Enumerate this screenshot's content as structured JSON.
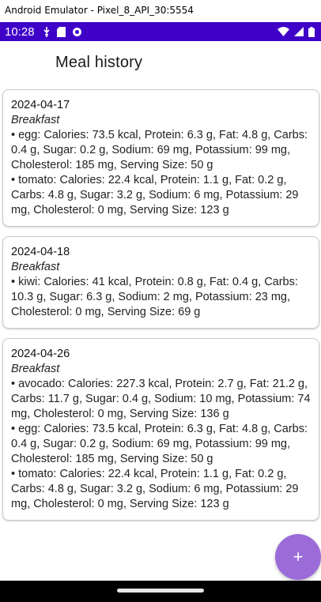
{
  "window": {
    "title": "Android Emulator - Pixel_8_API_30:5554"
  },
  "status_bar": {
    "time": "10:28",
    "icons": [
      "usb-debug-icon",
      "sd-card-icon",
      "sync-icon",
      "wifi-icon",
      "signal-icon",
      "battery-icon"
    ]
  },
  "header": {
    "title": "Meal history"
  },
  "meals": [
    {
      "date": "2024-04-17",
      "meal_type": "Breakfast",
      "items": [
        "• egg: Calories: 73.5 kcal, Protein: 6.3 g, Fat: 4.8 g, Carbs: 0.4 g, Sugar: 0.2 g, Sodium: 69 mg, Potassium: 99 mg, Cholesterol: 185 mg, Serving Size: 50 g",
        "• tomato: Calories: 22.4 kcal, Protein: 1.1 g, Fat: 0.2 g, Carbs: 4.8 g, Sugar: 3.2 g, Sodium: 6 mg, Potassium: 29 mg, Cholesterol: 0 mg, Serving Size: 123 g"
      ]
    },
    {
      "date": "2024-04-18",
      "meal_type": "Breakfast",
      "items": [
        "• kiwi: Calories: 41 kcal, Protein: 0.8 g, Fat: 0.4 g, Carbs: 10.3 g, Sugar: 6.3 g, Sodium: 2 mg, Potassium: 23 mg, Cholesterol: 0 mg, Serving Size: 69 g"
      ]
    },
    {
      "date": "2024-04-26",
      "meal_type": "Breakfast",
      "items": [
        "• avocado: Calories: 227.3 kcal, Protein: 2.7 g, Fat: 21.2 g, Carbs: 11.7 g, Sugar: 0.4 g, Sodium: 10 mg, Potassium: 74 mg, Cholesterol: 0 mg, Serving Size: 136 g",
        "• egg: Calories: 73.5 kcal, Protein: 6.3 g, Fat: 4.8 g, Carbs: 0.4 g, Sugar: 0.2 g, Sodium: 69 mg, Potassium: 99 mg, Cholesterol: 185 mg, Serving Size: 50 g",
        "• tomato: Calories: 22.4 kcal, Protein: 1.1 g, Fat: 0.2 g, Carbs: 4.8 g, Sugar: 3.2 g, Sodium: 6 mg, Potassium: 29 mg, Cholesterol: 0 mg, Serving Size: 123 g"
      ]
    }
  ],
  "fab": {
    "label": "+",
    "icon": "add-icon"
  },
  "colors": {
    "status_bar": "#3f00c8",
    "fab": "#9b6bd8",
    "card_border": "#c9c9c9"
  }
}
